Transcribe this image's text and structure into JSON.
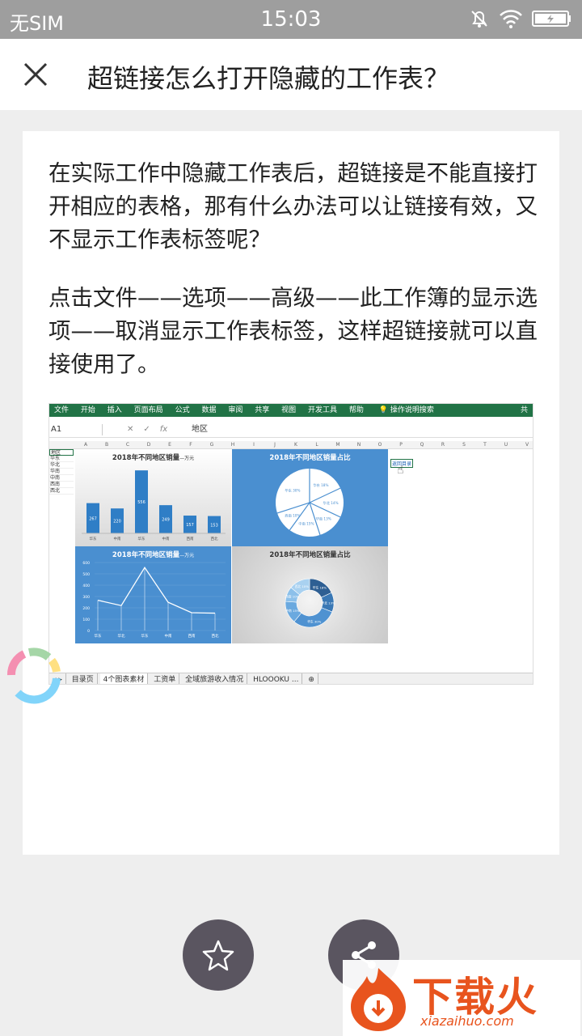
{
  "status_bar": {
    "carrier": "无SIM",
    "time": "15:03"
  },
  "app_bar": {
    "title": "超链接怎么打开隐藏的工作表？"
  },
  "article": {
    "paragraph_1": "在实际工作中隐藏工作表后，超链接是不能直接打开相应的表格，那有什么办法可以让链接有效，又不显示工作表标签呢？",
    "paragraph_2": "点击文件——选项——高级——此工作簿的显示选项——取消显示工作表标签，这样超链接就可以直接使用了。"
  },
  "excel": {
    "ribbon_tabs": [
      "文件",
      "开始",
      "插入",
      "页面布局",
      "公式",
      "数据",
      "审阅",
      "共享",
      "视图",
      "开发工具",
      "帮助"
    ],
    "ribbon_hint": "操作说明搜索",
    "ribbon_share": "共",
    "name_box": "A1",
    "formula_value": "地区",
    "columns": [
      "A",
      "B",
      "C",
      "D",
      "E",
      "F",
      "G",
      "H",
      "I",
      "J",
      "K",
      "L",
      "M",
      "N",
      "O",
      "P",
      "Q",
      "R",
      "S",
      "T",
      "U",
      "V"
    ],
    "row_labels": [
      "地区",
      "华东",
      "华北",
      "华南",
      "中南",
      "西南",
      "西北"
    ],
    "hyperlink_text": "返回目录",
    "sheet_tabs": [
      "目录页",
      "4个图表素材",
      "工资单",
      "全域旅游收入情况",
      "HLOOOKU ..."
    ],
    "active_sheet": "4个图表素材",
    "charts": [
      {
        "title": "2018年不同地区销量",
        "unit": "—万元",
        "type": "bar",
        "categories": [
          "华东",
          "中南",
          "华东",
          "中南",
          "西南",
          "西北"
        ],
        "values": [
          267,
          220,
          556,
          249,
          157,
          153
        ]
      },
      {
        "title": "2018年不同地区销量占比",
        "type": "pie",
        "labels": [
          "华东 18%",
          "华北 14%",
          "华南 13%",
          "中南 15%",
          "西南 10%",
          "华东 30%"
        ]
      },
      {
        "title": "2018年不同地区销量",
        "unit": "—万元",
        "type": "line",
        "categories": [
          "华东",
          "华北",
          "华东",
          "中南",
          "西南",
          "西北"
        ],
        "values": [
          267,
          220,
          556,
          249,
          157,
          153
        ],
        "yticks": [
          "600",
          "500",
          "400",
          "300",
          "200",
          "100",
          "0"
        ]
      },
      {
        "title": "2018年不同地区销量占比",
        "type": "donut",
        "labels": [
          "华东 18%",
          "华北 13%",
          "华东 30%",
          "中南 15%",
          "西南 10%",
          "西北 10%"
        ]
      }
    ]
  },
  "watermark": {
    "brand": "下载火",
    "url": "xiazaihuo.com"
  },
  "colors": {
    "excel_green": "#217346",
    "chart_blue": "#5b9bd5",
    "fab": "#5a5560",
    "brand_orange": "#e8541e"
  },
  "icons": [
    "close-icon",
    "star-icon",
    "share-icon",
    "wifi-icon",
    "battery-icon",
    "mute-icon"
  ]
}
